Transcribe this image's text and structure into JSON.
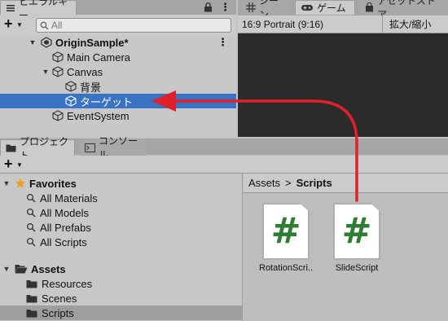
{
  "hierarchy": {
    "tab_label": "ヒエラルキー",
    "add_label": "+",
    "search_placeholder": "All",
    "rows": [
      {
        "label": "OriginSample*",
        "icon": "unity-scene-icon"
      },
      {
        "label": "Main Camera",
        "icon": "gameobject-cube-icon"
      },
      {
        "label": "Canvas",
        "icon": "gameobject-cube-icon"
      },
      {
        "label": "背景",
        "icon": "gameobject-cube-icon"
      },
      {
        "label": "ターゲット",
        "icon": "gameobject-cube-icon",
        "selected": true
      },
      {
        "label": "EventSystem",
        "icon": "gameobject-cube-icon"
      }
    ]
  },
  "game": {
    "tabs": [
      {
        "label": "シーン",
        "icon": "grid-icon"
      },
      {
        "label": "ゲーム",
        "icon": "gamepad-icon"
      },
      {
        "label": "アセットストア",
        "icon": "shopping-bag-icon"
      }
    ],
    "resolution": "16:9 Portrait (9:16)",
    "scale_label": "拡大/縮小"
  },
  "project": {
    "tabs": [
      {
        "label": "プロジェクト",
        "icon": "folder-icon"
      },
      {
        "label": "コンソール",
        "icon": "console-icon"
      }
    ],
    "add_label": "+",
    "favorites": {
      "label": "Favorites",
      "items": [
        "All Materials",
        "All Models",
        "All Prefabs",
        "All Scripts"
      ]
    },
    "assets": {
      "label": "Assets",
      "folders": [
        "Resources",
        "Scenes",
        "Scripts"
      ]
    },
    "breadcrumb": {
      "root": "Assets",
      "separator": ">",
      "current": "Scripts"
    },
    "files": [
      {
        "name": "RotationScri...",
        "glyph": "#"
      },
      {
        "name": "SlideScript",
        "glyph": "#"
      }
    ]
  },
  "colors": {
    "selection": "#3a72c4",
    "script_hash": "#2e7d32",
    "annotation_arrow": "#e0202a",
    "star": "#e8a317"
  }
}
